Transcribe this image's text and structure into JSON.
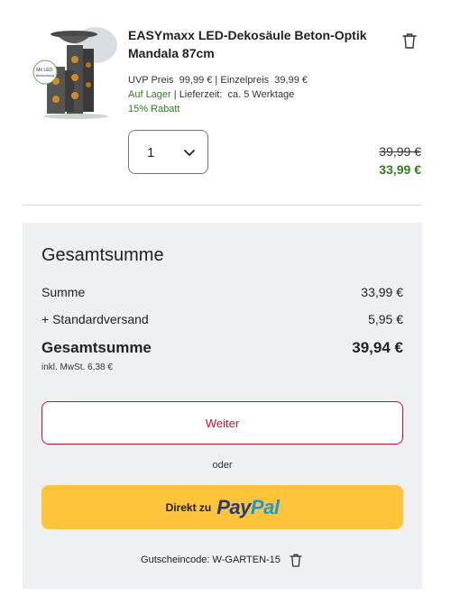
{
  "product": {
    "image_badge": "Mit LED-Beleuchtung",
    "title": "EASYmaxx LED-Dekosäule Beton-Optik Mandala 87cm",
    "uvp_label": "UVP Preis",
    "uvp_value": "99,99 €",
    "unit_label": "Einzelpreis",
    "unit_value": "39,99 €",
    "stock": "Auf Lager",
    "delivery_label": "Lieferzeit:",
    "delivery_value": "ca. 5 Werktage",
    "discount": "15% Rabatt",
    "quantity": "1",
    "price_old": "39,99 €",
    "price_new": "33,99 €",
    "remove_icon": "trash-icon"
  },
  "summary": {
    "heading": "Gesamtsumme",
    "subtotal_label": "Summe",
    "subtotal_value": "33,99 €",
    "shipping_label": "+ Standardversand",
    "shipping_value": "5,95 €",
    "total_label": "Gesamtsumme",
    "total_value": "39,94 €",
    "vat_note": "inkl. MwSt. 6,38 €",
    "continue_label": "Weiter",
    "or_label": "oder",
    "paypal_prefix": "Direkt zu",
    "paypal_brand_1": "Pay",
    "paypal_brand_2": "Pal",
    "coupon_label": "Gutscheincode: W-GARTEN-15"
  },
  "colors": {
    "accent_red": "#c8102e",
    "success_green": "#2e7d1e",
    "paypal_yellow": "#ffc439",
    "panel_bg": "#eef0f2"
  }
}
